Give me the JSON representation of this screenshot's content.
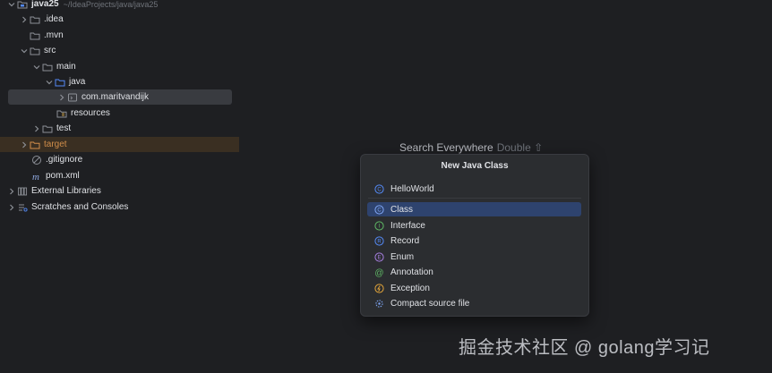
{
  "project": {
    "name": "java25",
    "path": "~/IdeaProjects/java/java25"
  },
  "tree": {
    "idea": ".idea",
    "mvn": ".mvn",
    "src": "src",
    "main": "main",
    "java": "java",
    "package": "com.maritvandijk",
    "resources": "resources",
    "test": "test",
    "target": "target",
    "gitignore": ".gitignore",
    "pom": "pom.xml",
    "external_libraries": "External Libraries",
    "scratches": "Scratches and Consoles"
  },
  "search_everywhere": {
    "label": "Search Everywhere",
    "shortcut": "Double ⇧"
  },
  "popup": {
    "title": "New Java Class",
    "top_item": "HelloWorld",
    "items": [
      "Class",
      "Interface",
      "Record",
      "Enum",
      "Annotation",
      "Exception",
      "Compact source file"
    ],
    "selected": "Class"
  },
  "watermark": "掘金技术社区 @ golang学习记",
  "colors": {
    "background": "#1e1f22",
    "popup": "#2b2d30",
    "selection": "#2e436e",
    "target_folder": "#d18e4a",
    "class_icon": "#548af7"
  }
}
